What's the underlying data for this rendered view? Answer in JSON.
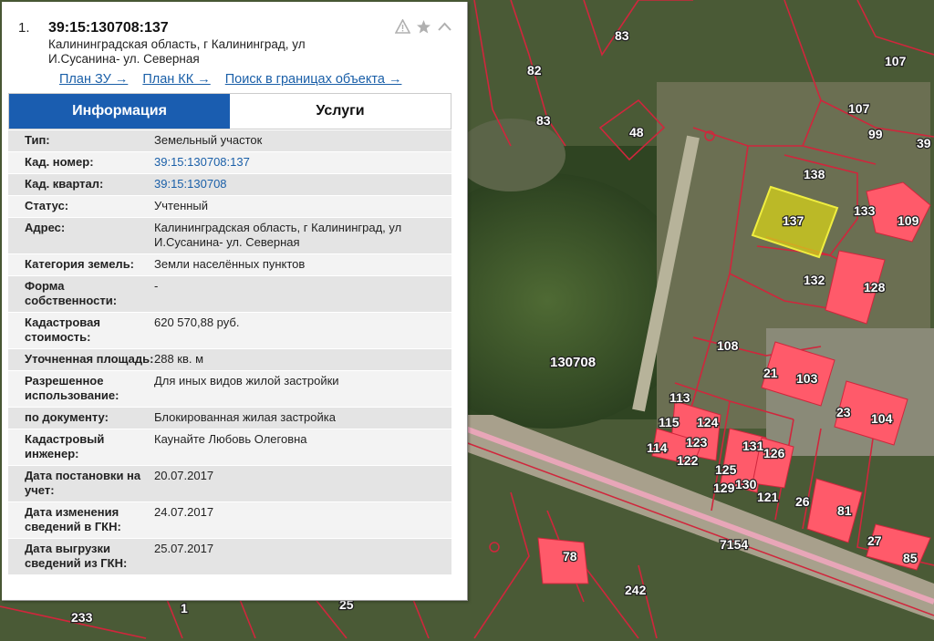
{
  "map": {
    "colors": {
      "boundary": "#d0263c",
      "building": "#ff5a6a",
      "selected": "#d6d21a",
      "road": "#e8a6b8"
    },
    "quarter_label": "130708",
    "parcel_labels": [
      "83",
      "82",
      "83",
      "48",
      "107",
      "107",
      "99",
      "39",
      "138",
      "137",
      "133",
      "109",
      "132",
      "128",
      "108",
      "21",
      "103",
      "23",
      "104",
      "113",
      "115",
      "124",
      "123",
      "114",
      "122",
      "125",
      "131",
      "126",
      "130",
      "129",
      "121",
      "26",
      "81",
      "27",
      "85",
      "78",
      "7154",
      "242",
      "233",
      "1",
      "25"
    ]
  },
  "panel": {
    "index": "1.",
    "cad_number": "39:15:130708:137",
    "address": "Калининградская область, г Калининград, ул И.Сусанина- ул. Северная",
    "icons": [
      "warning-icon",
      "star-icon",
      "chevron-up-icon"
    ],
    "links": [
      "План ЗУ →",
      "План КК →",
      "Поиск в границах объекта →"
    ],
    "tabs": {
      "info": "Информация",
      "services": "Услуги"
    },
    "rows": [
      {
        "key": "Тип:",
        "value": "Земельный участок"
      },
      {
        "key": "Кад. номер:",
        "value": "39:15:130708:137"
      },
      {
        "key": "Кад. квартал:",
        "value": "39:15:130708"
      },
      {
        "key": "Статус:",
        "value": "Учтенный"
      },
      {
        "key": "Адрес:",
        "value": "Калининградская область, г Калининград, ул И.Сусанина- ул. Северная"
      },
      {
        "key": "Категория земель:",
        "value": "Земли населённых пунктов"
      },
      {
        "key": "Форма собственности:",
        "value": "-"
      },
      {
        "key": "Кадастровая стоимость:",
        "value": "620 570,88 руб."
      },
      {
        "key": "Уточненная площадь:",
        "value": "288 кв. м"
      },
      {
        "key": "Разрешенное использование:",
        "value": "Для иных видов жилой застройки"
      },
      {
        "key": "по документу:",
        "value": "Блокированная жилая застройка"
      },
      {
        "key": "Кадастровый инженер:",
        "value": "Каунайте Любовь Олеговна"
      },
      {
        "key": "Дата постановки на учет:",
        "value": "20.07.2017"
      },
      {
        "key": "Дата изменения сведений в ГКН:",
        "value": "24.07.2017"
      },
      {
        "key": "Дата выгрузки сведений из ГКН:",
        "value": "25.07.2017"
      }
    ]
  }
}
